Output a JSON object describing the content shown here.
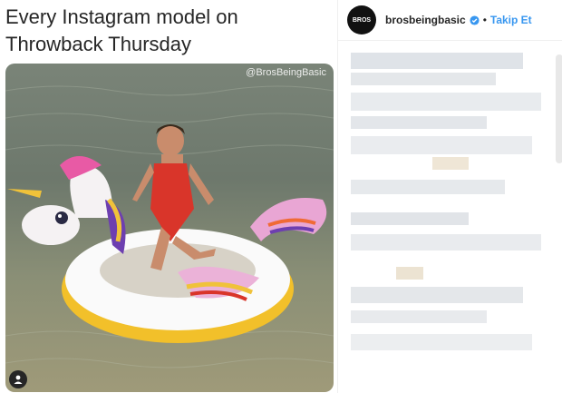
{
  "caption": "Every Instagram model on Throwback Thursday",
  "watermark": "@BrosBeingBasic",
  "header": {
    "username": "brosbeingbasic",
    "separator": "•",
    "follow_label": "Takip Et",
    "avatar_text": "BROS"
  },
  "colors": {
    "accent": "#3897f0",
    "text": "#262626"
  }
}
